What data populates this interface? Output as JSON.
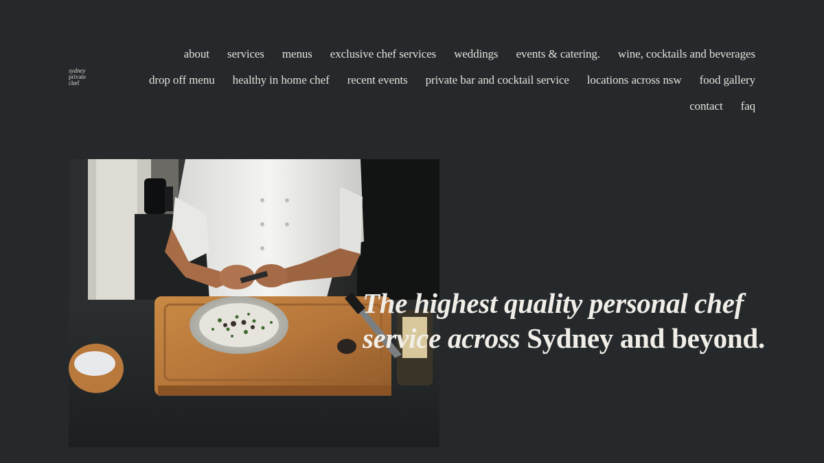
{
  "logo": {
    "line1": "sydney",
    "line2": "private",
    "line3": "chef"
  },
  "nav": {
    "row1": [
      {
        "label": "about"
      },
      {
        "label": "services"
      },
      {
        "label": "menus"
      },
      {
        "label": "exclusive chef services"
      },
      {
        "label": "weddings"
      },
      {
        "label": "events & catering."
      },
      {
        "label": "wine, cocktails and beverages"
      }
    ],
    "row2": [
      {
        "label": "drop off menu"
      },
      {
        "label": "healthy in home chef"
      },
      {
        "label": "recent events"
      },
      {
        "label": "private bar and cocktail service"
      },
      {
        "label": "locations across nsw"
      },
      {
        "label": "food gallery"
      }
    ],
    "row3": [
      {
        "label": "contact"
      },
      {
        "label": "faq"
      }
    ]
  },
  "hero": {
    "headline_italic": "The highest quality personal chef service across",
    "headline_regular": " Sydney and beyond."
  },
  "colors": {
    "background": "#25292c",
    "text": "#e9e6df"
  }
}
